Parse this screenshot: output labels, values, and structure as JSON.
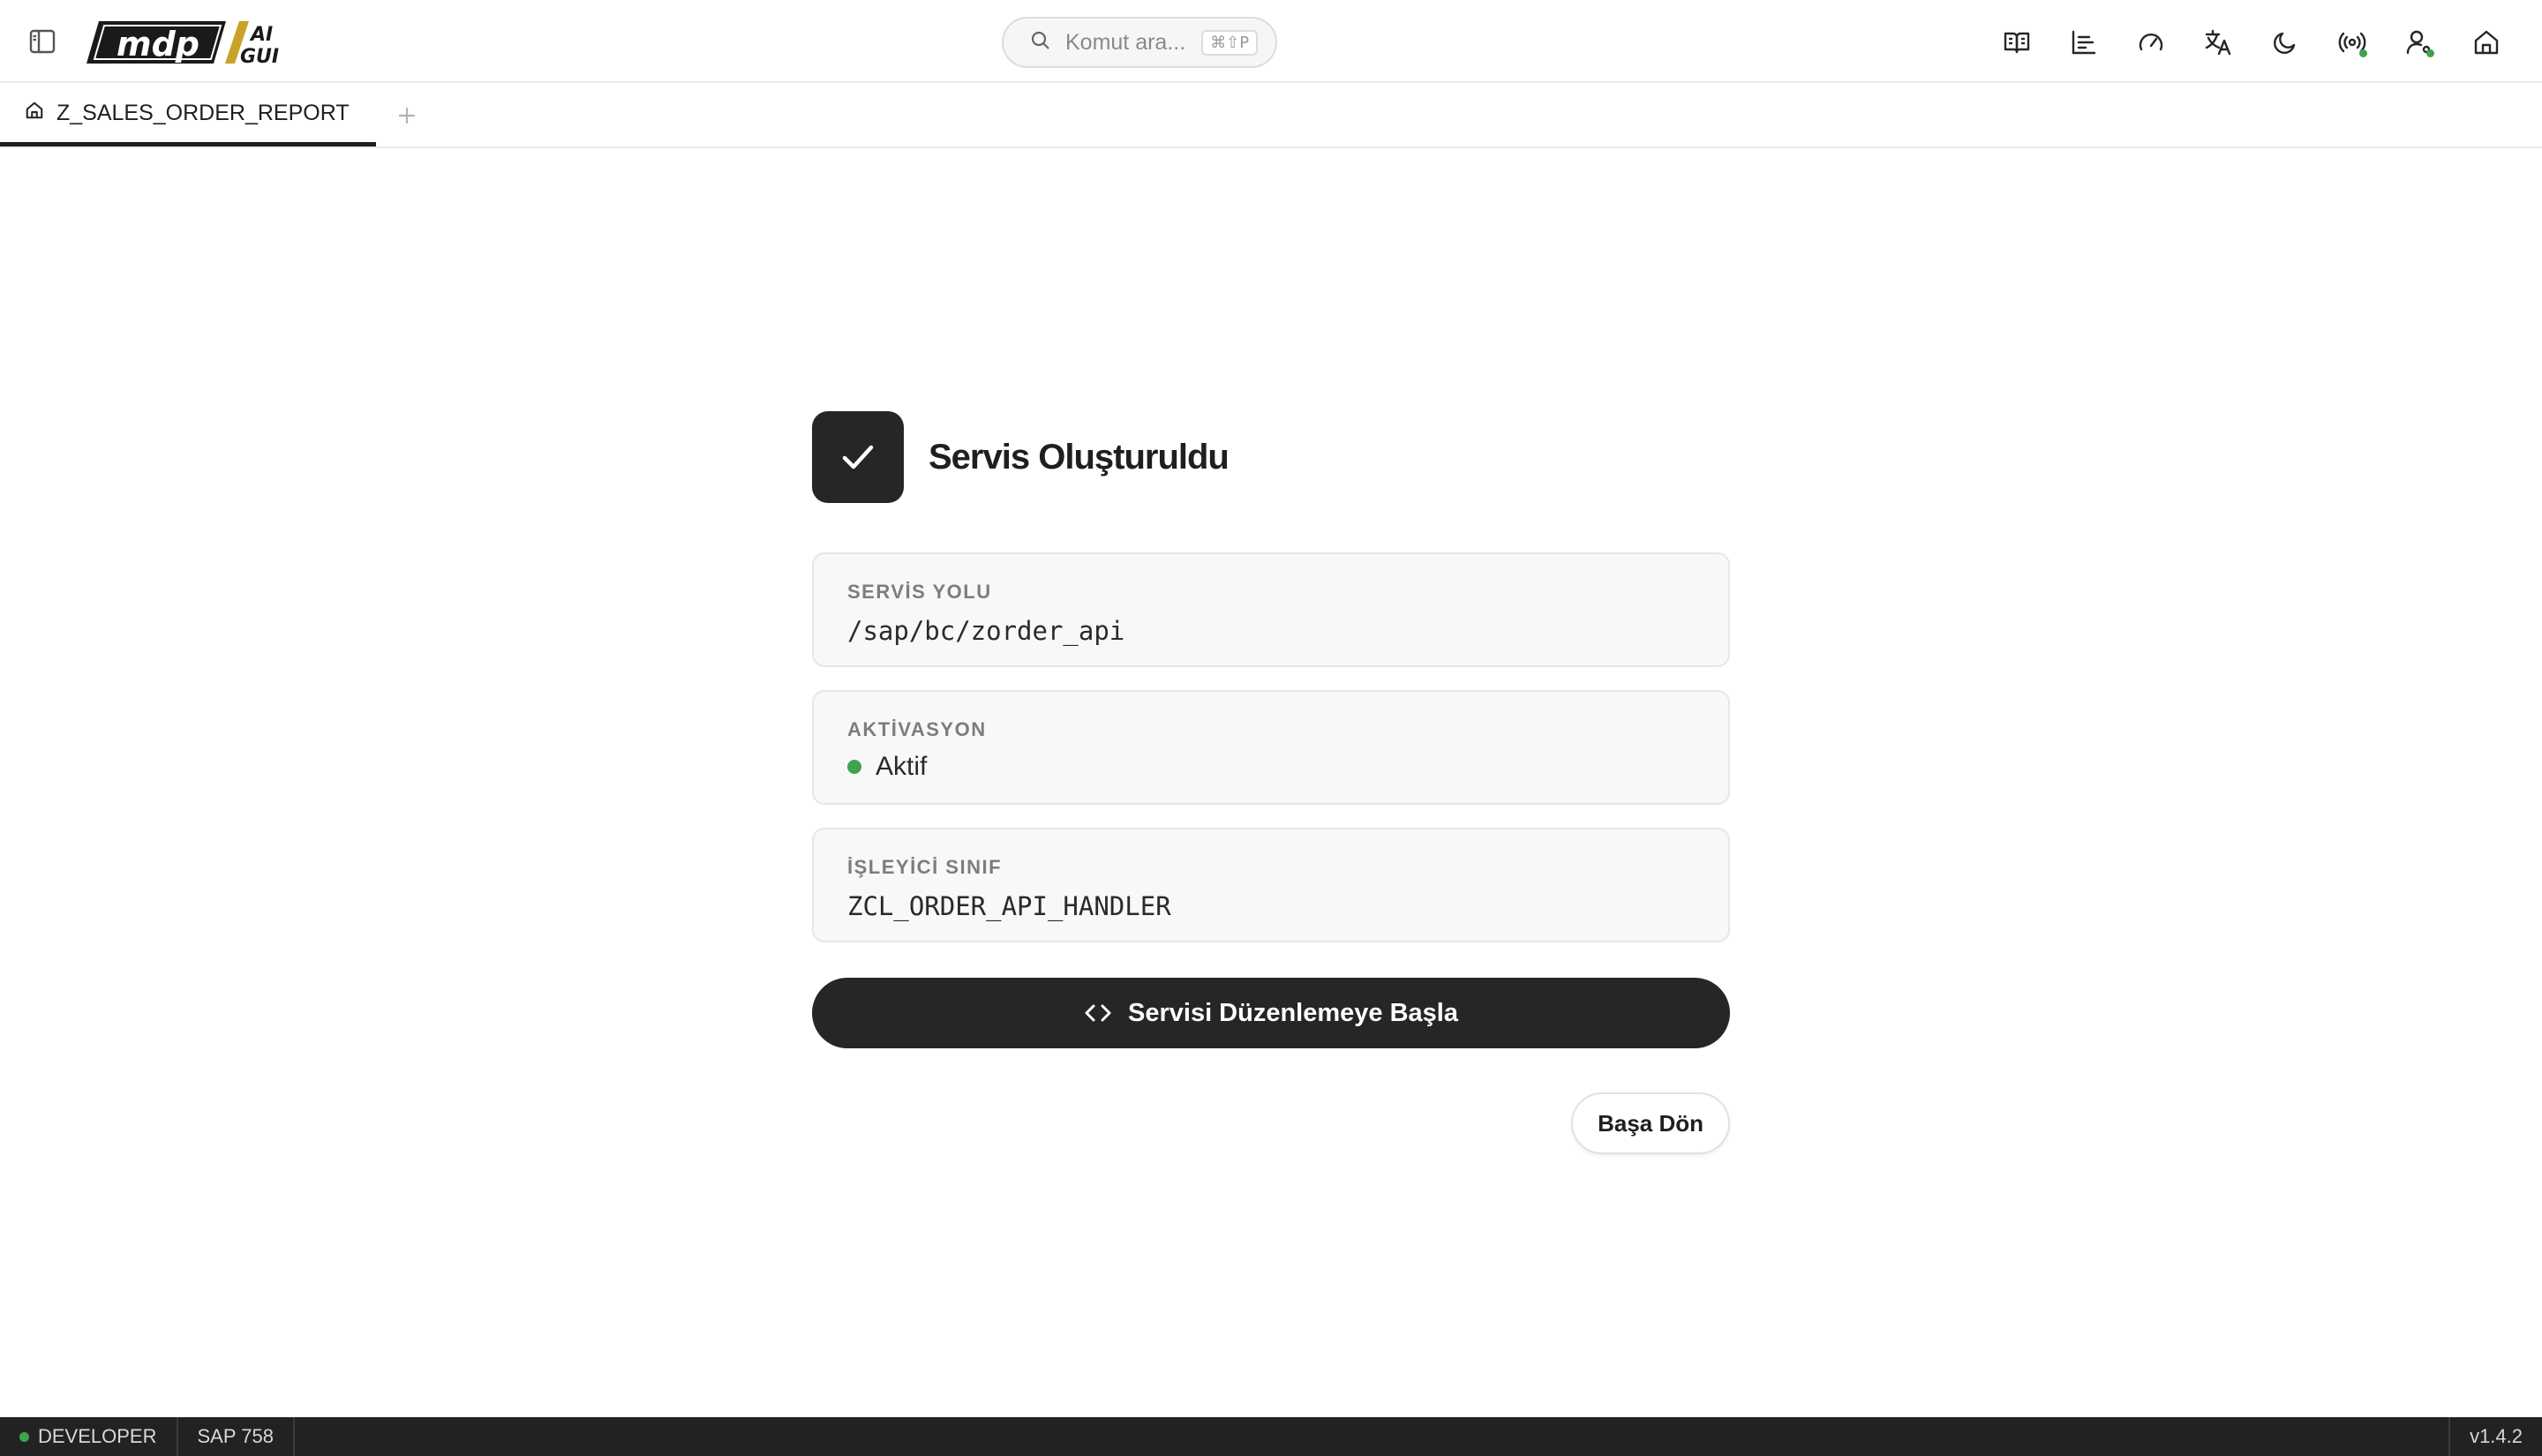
{
  "app": {
    "logo_main": "mdp",
    "logo_sub_top": "AI",
    "logo_sub_bottom": "GUI"
  },
  "search": {
    "placeholder": "Komut ara...",
    "shortcut": "⌘⇧P"
  },
  "toolbar": {
    "icons": [
      "book-open-icon",
      "bar-chart-icon",
      "gauge-icon",
      "translate-icon",
      "moon-icon",
      "broadcast-icon",
      "user-settings-icon",
      "home-icon"
    ]
  },
  "tabs": [
    {
      "label": "Z_SALES_ORDER_REPORT",
      "icon": "home-icon",
      "active": true
    }
  ],
  "result": {
    "title": "Servis Oluşturuldu",
    "service_path": {
      "label": "SERVİS YOLU",
      "value": "/sap/bc/zorder_api"
    },
    "activation": {
      "label": "AKTİVASYON",
      "value": "Aktif",
      "status_color": "#3fa34d"
    },
    "handler_class": {
      "label": "İŞLEYİCİ SINIF",
      "value": "ZCL_ORDER_API_HANDLER"
    },
    "primary_button": "Servisi Düzenlemeye Başla",
    "secondary_button": "Başa Dön"
  },
  "statusbar": {
    "environment": "DEVELOPER",
    "system": "SAP 758",
    "version": "v1.4.2"
  },
  "colors": {
    "accent_dark": "#262626",
    "status_green": "#3fa34d"
  }
}
